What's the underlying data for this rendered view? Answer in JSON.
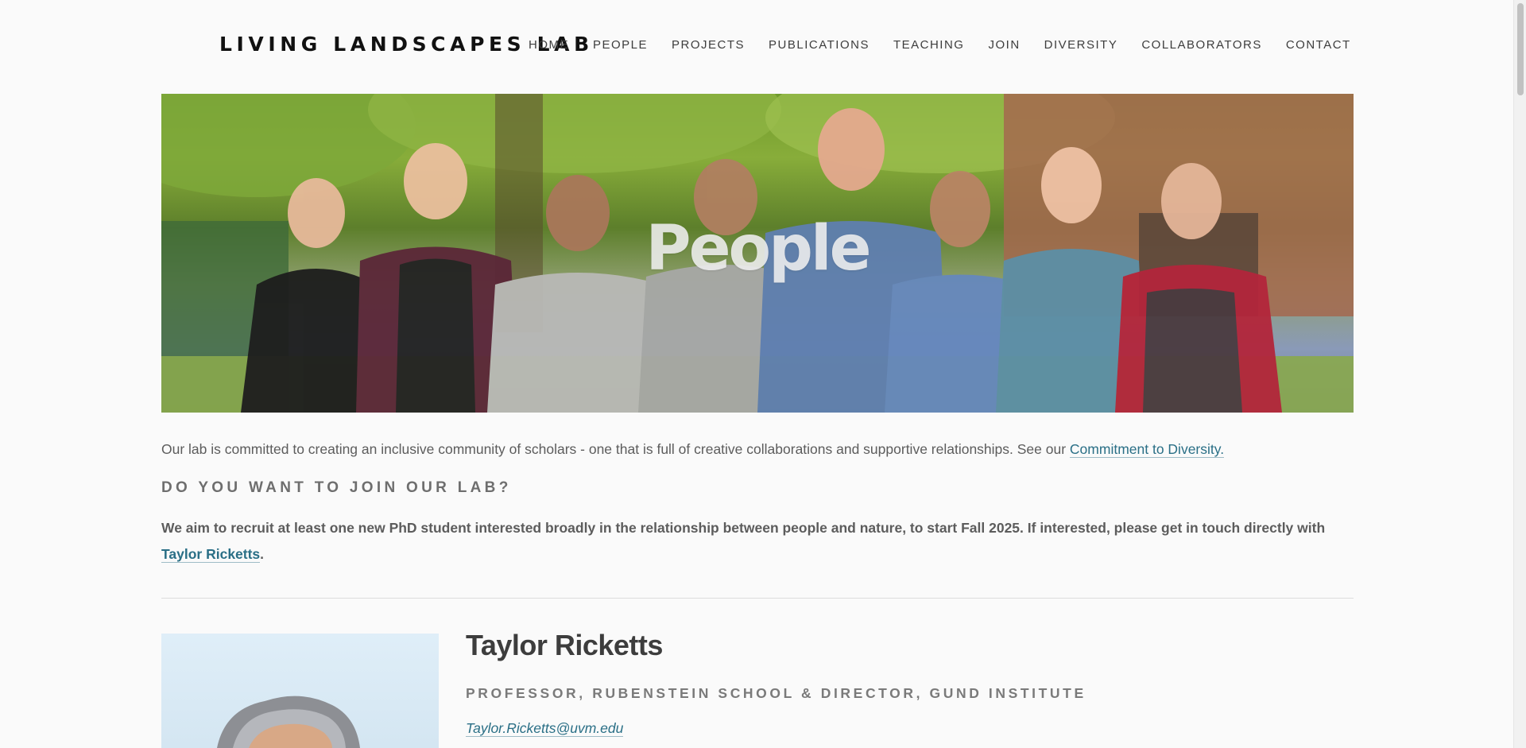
{
  "header": {
    "logo": "LIVING LANDSCAPES LAB",
    "nav": [
      "HOME",
      "PEOPLE",
      "PROJECTS",
      "PUBLICATIONS",
      "TEACHING",
      "JOIN",
      "DIVERSITY",
      "COLLABORATORS",
      "CONTACT"
    ]
  },
  "hero": {
    "title": "People"
  },
  "intro": {
    "text": "Our lab is committed to creating an inclusive community of scholars - one that is full of creative collaborations and supportive relationships. See our ",
    "link": "Commitment to Diversity."
  },
  "join": {
    "heading": "DO YOU WANT TO JOIN OUR LAB?",
    "text": "We aim to recruit at least one new PhD student interested broadly in the relationship between people and nature, to start Fall 2025. If interested, please get in touch directly with ",
    "link": "Taylor Ricketts",
    "suffix": "."
  },
  "profile": {
    "name": "Taylor Ricketts",
    "title": "PROFESSOR, RUBENSTEIN SCHOOL & DIRECTOR, GUND INSTITUTE",
    "email": "Taylor.Ricketts@uvm.edu"
  },
  "colors": {
    "link": "#2a6f86",
    "text": "#5c5c5c",
    "background": "#fafafa"
  }
}
